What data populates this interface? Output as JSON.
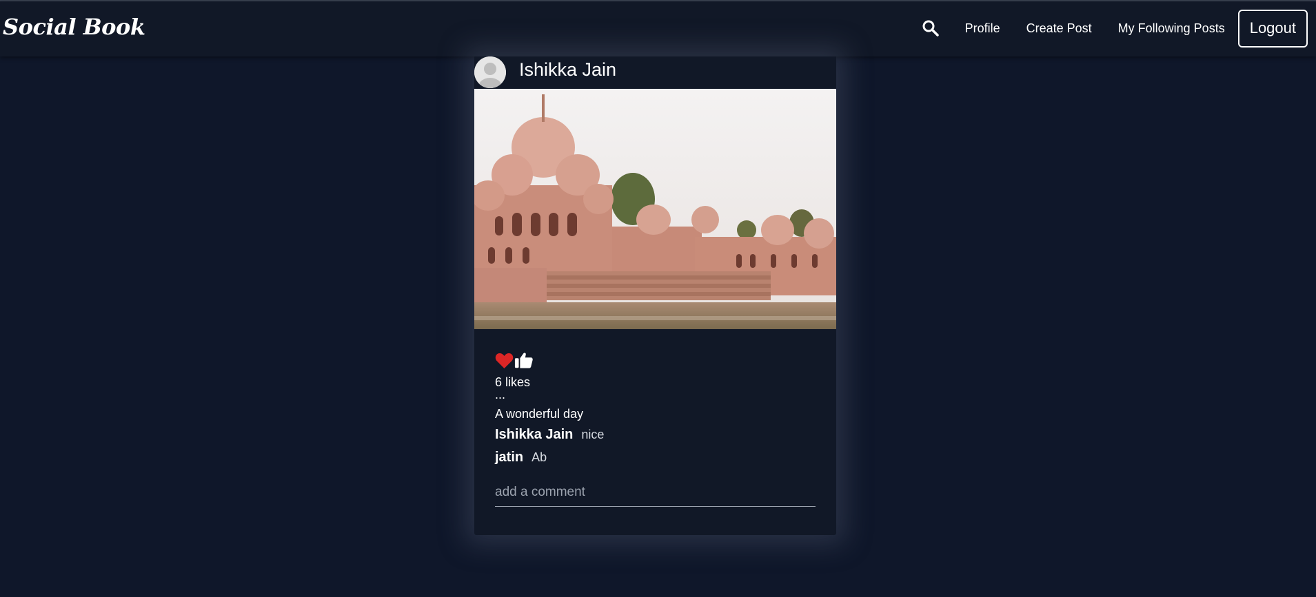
{
  "navbar": {
    "brand": "Social Book",
    "search_icon": "search-icon",
    "links": [
      "Profile",
      "Create Post",
      "My Following Posts"
    ],
    "logout_label": "Logout"
  },
  "post": {
    "author": "Ishikka Jain",
    "avatar_icon": "default-avatar-icon",
    "image_alt": "temple-by-lake-photo",
    "like_icon": "heart-icon",
    "thumb_icon": "thumbs-up-icon",
    "likes_text": "6 likes",
    "dots": "...",
    "caption": "A wonderful day",
    "comments": [
      {
        "user": "Ishikka Jain",
        "text": "nice"
      },
      {
        "user": "jatin",
        "text": "Ab"
      }
    ],
    "comment_placeholder": "add a comment"
  },
  "colors": {
    "background": "#0f172a",
    "navbar": "#111827",
    "heart": "#dc2626"
  }
}
